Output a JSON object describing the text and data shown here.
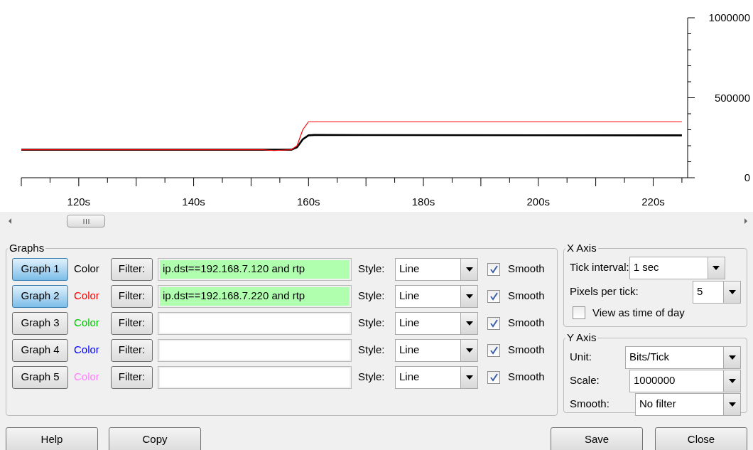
{
  "chart": {
    "chart_data": {
      "type": "line",
      "x": [
        110,
        152,
        154,
        157,
        158,
        159,
        160,
        161,
        225
      ],
      "series": [
        {
          "color": "#000000",
          "values": [
            175000,
            175000,
            175000,
            175000,
            190000,
            240000,
            265000,
            267000,
            265000
          ]
        },
        {
          "color": "#ff0000",
          "values": [
            175000,
            175000,
            170000,
            175000,
            200000,
            300000,
            350000,
            350000,
            350000
          ]
        }
      ],
      "xlim": [
        110,
        226
      ],
      "ylim": [
        0,
        1000000
      ],
      "xticks": [
        {
          "value": 120,
          "label": "120s"
        },
        {
          "value": 140,
          "label": "140s"
        },
        {
          "value": 160,
          "label": "160s"
        },
        {
          "value": 180,
          "label": "180s"
        },
        {
          "value": 200,
          "label": "200s"
        },
        {
          "value": 220,
          "label": "220s"
        }
      ],
      "yticks": [
        0,
        500000,
        1000000
      ]
    }
  },
  "graphs": {
    "title": "Graphs",
    "rows": [
      {
        "button": "Graph 1",
        "selected": true,
        "color_label": "Color",
        "color": "#000000",
        "filter_button": "Filter:",
        "filter": "ip.dst==192.168.7.120 and rtp",
        "valid": true,
        "style_label": "Style:",
        "style": "Line",
        "smooth_label": "Smooth",
        "checked": true
      },
      {
        "button": "Graph 2",
        "selected": true,
        "color_label": "Color",
        "color": "#ff0000",
        "filter_button": "Filter:",
        "filter": "ip.dst==192.168.7.220 and rtp",
        "valid": true,
        "style_label": "Style:",
        "style": "Line",
        "smooth_label": "Smooth",
        "checked": true
      },
      {
        "button": "Graph 3",
        "selected": false,
        "color_label": "Color",
        "color": "#00c800",
        "filter_button": "Filter:",
        "valid": false,
        "style_label": "Style:",
        "style": "Line",
        "smooth_label": "Smooth",
        "checked": true
      },
      {
        "button": "Graph 4",
        "selected": false,
        "color_label": "Color",
        "color": "#0000ff",
        "filter_button": "Filter:",
        "valid": false,
        "style_label": "Style:",
        "style": "Line",
        "smooth_label": "Smooth",
        "checked": true
      },
      {
        "button": "Graph 5",
        "selected": false,
        "color_label": "Color",
        "color": "#ff80ff",
        "filter_button": "Filter:",
        "valid": false,
        "style_label": "Style:",
        "style": "Line",
        "smooth_label": "Smooth",
        "checked": true
      }
    ]
  },
  "x_axis": {
    "title": "X Axis",
    "tick_interval_label": "Tick interval:",
    "tick_interval": "1 sec",
    "pixels_label": "Pixels per tick:",
    "pixels": "5",
    "time_of_day_label": "View as time of day",
    "time_of_day_checked": false
  },
  "y_axis": {
    "title": "Y Axis",
    "unit_label": "Unit:",
    "unit": "Bits/Tick",
    "scale_label": "Scale:",
    "scale": "1000000",
    "smooth_label": "Smooth:",
    "smooth": "No filter"
  },
  "buttons": {
    "left": [
      "Help",
      "Copy"
    ],
    "right": [
      "Save",
      "Close"
    ]
  }
}
